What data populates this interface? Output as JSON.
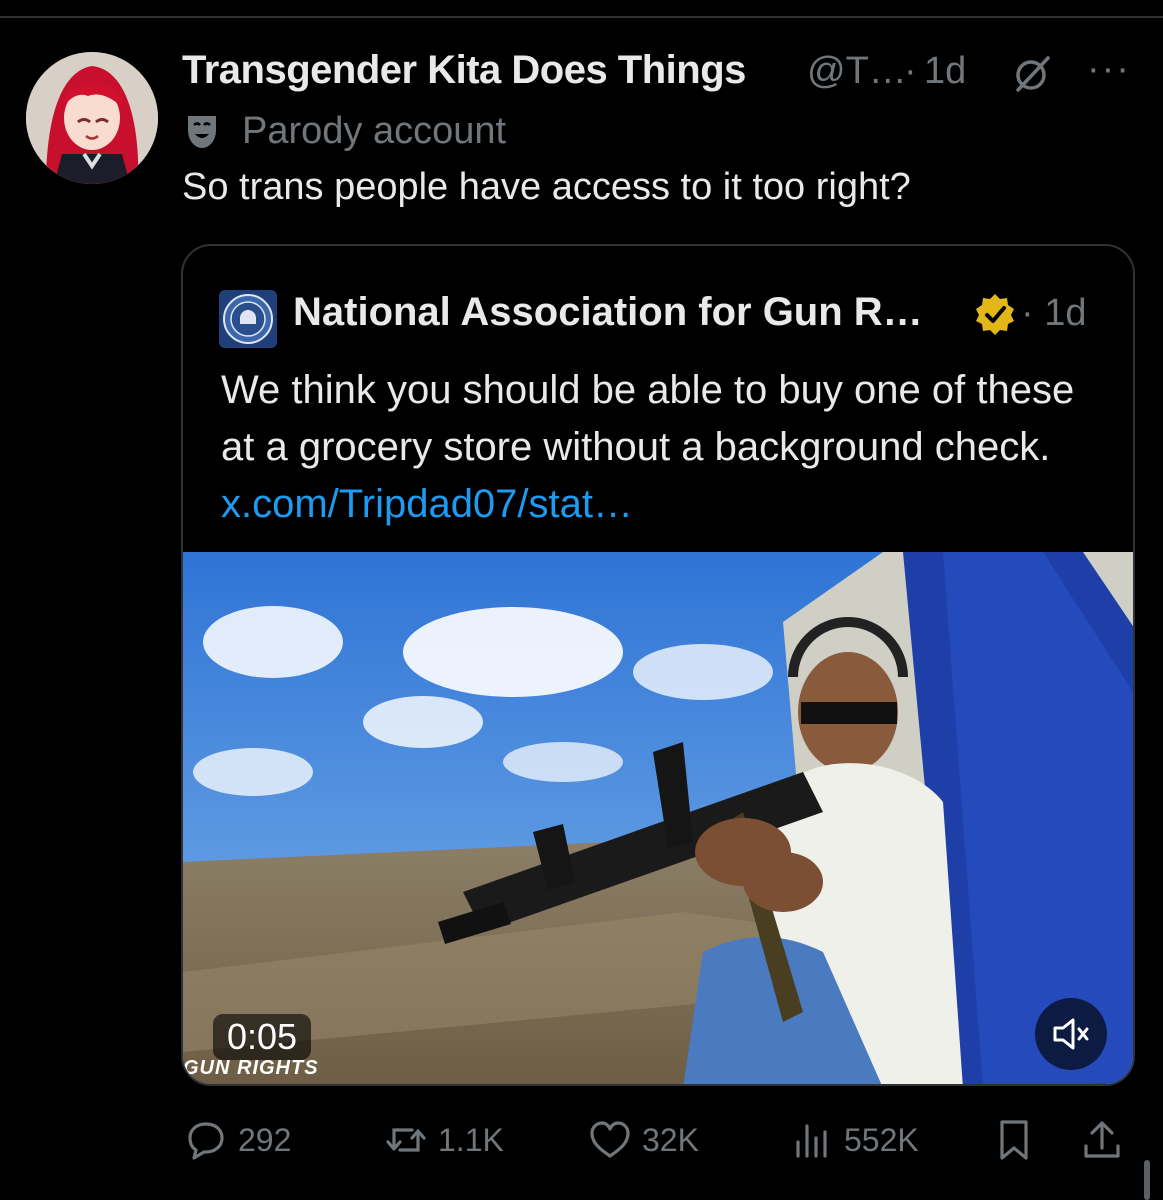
{
  "tweet": {
    "display_name": "Transgender Kita Does Things",
    "handle": "@T…",
    "separator": "·",
    "time": "1d",
    "more": "···",
    "parody_label": "Parody account",
    "text": "So trans people have access to it too right?",
    "avatar_icon": "anime-avatar"
  },
  "quote": {
    "display_name": "National Association for Gun R…",
    "separator": "·",
    "time": "1d",
    "text": "We think you should be able to buy one of these at a grocery store without a background check.",
    "link": "x.com/Tripdad07/stat…",
    "verified_color": "#e2b719",
    "media": {
      "duration": "0:05",
      "watermark": "GUN RIGHTS",
      "muted": true
    }
  },
  "actions": {
    "replies": "292",
    "reposts": "1.1K",
    "likes": "32K",
    "views": "552K"
  },
  "colors": {
    "background": "#000000",
    "text": "#e7e9ea",
    "secondary": "#71767b",
    "link": "#1d9bf0",
    "border": "#2f3336"
  }
}
